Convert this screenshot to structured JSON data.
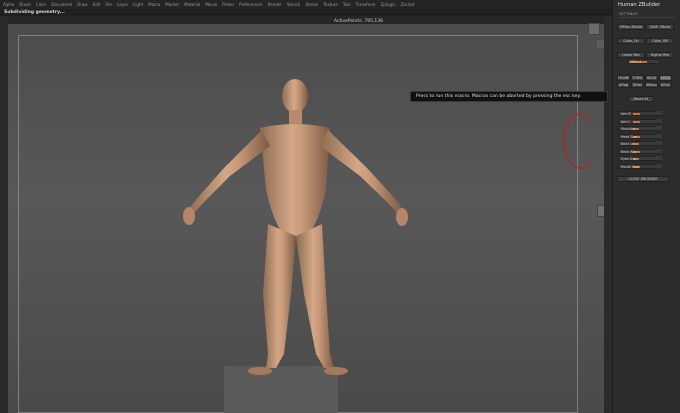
{
  "menubar": {
    "items": [
      "Alpha",
      "Brush",
      "Color",
      "Document",
      "Draw",
      "Edit",
      "File",
      "Layer",
      "Light",
      "Macro",
      "Marker",
      "Material",
      "Movie",
      "Picker",
      "Preferences",
      "Render",
      "Stencil",
      "Stroke",
      "Texture",
      "Tool",
      "Transform",
      "Zplugin",
      "Zscript"
    ]
  },
  "status": {
    "text": "Subdividing geometry..."
  },
  "viewport": {
    "title": "ActivePoints: 795,136"
  },
  "tooltip": {
    "text": "Press to run this macro. Macros can be aborted by pressing the esc key."
  },
  "panel": {
    "title": "Human ZBuilder",
    "subtitle": "SETTINGS",
    "row1": [
      "ERRor ZBuild",
      "SAVE ZBuild"
    ],
    "row2": [
      "Color_On",
      "Color_Off"
    ],
    "row3": [
      "Lower Res",
      "Higher Res"
    ],
    "sdiv_label": "SDiv 4",
    "row4": [
      "FIGURE",
      "TORSO",
      "HEAD",
      "LEGS"
    ],
    "row5": [
      "AFlag",
      "BFlat",
      "BRusu",
      "BFlat"
    ],
    "reset_label": "_Reset All_",
    "sliders": [
      {
        "label": "Arm R",
        "fill": 0.55
      },
      {
        "label": "Arm L",
        "fill": 0.55
      },
      {
        "label": "Shoulder",
        "fill": 0.5
      },
      {
        "label": "Head Size",
        "fill": 0.6
      },
      {
        "label": "Neck Len",
        "fill": 0.52
      },
      {
        "label": "Neck Wid",
        "fill": 0.58
      },
      {
        "label": "Eyes Size",
        "fill": 0.5
      },
      {
        "label": "Mouth Size",
        "fill": 0.55
      }
    ],
    "close_label": "CLOSE ZBUILDER"
  },
  "colors": {
    "accent": "#d0702a",
    "viewport_bg": "#555555",
    "panel_bg": "#2c2c2c"
  }
}
